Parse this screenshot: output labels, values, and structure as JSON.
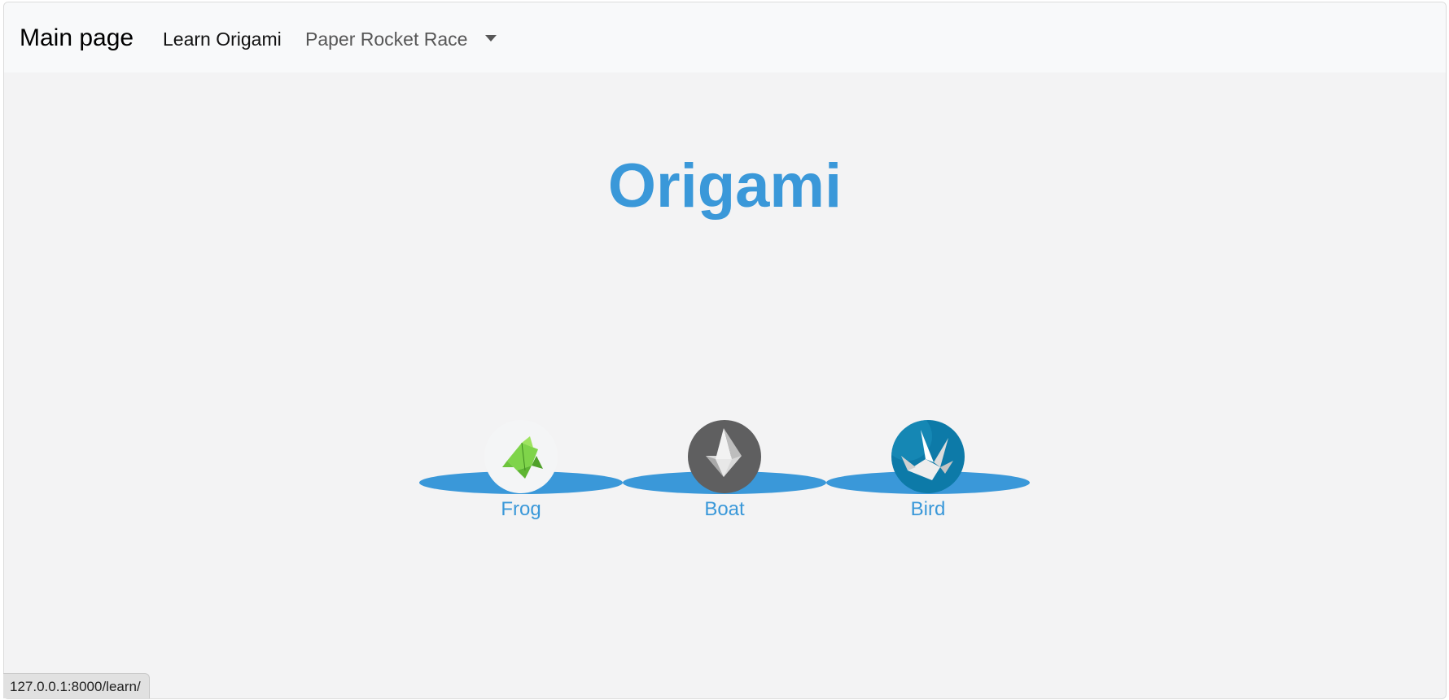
{
  "navbar": {
    "brand": "Main page",
    "links": [
      {
        "label": "Learn Origami"
      },
      {
        "label": "Paper Rocket Race"
      }
    ]
  },
  "main": {
    "title": "Origami",
    "items": [
      {
        "label": "Frog",
        "icon": "frog-origami-icon"
      },
      {
        "label": "Boat",
        "icon": "boat-origami-icon"
      },
      {
        "label": "Bird",
        "icon": "crane-origami-icon"
      }
    ]
  },
  "statusbar": {
    "url": "127.0.0.1:8000/learn/"
  },
  "colors": {
    "accent": "#3a98d9",
    "navbar_bg": "#f8f9fa",
    "page_bg": "#f3f3f4"
  }
}
